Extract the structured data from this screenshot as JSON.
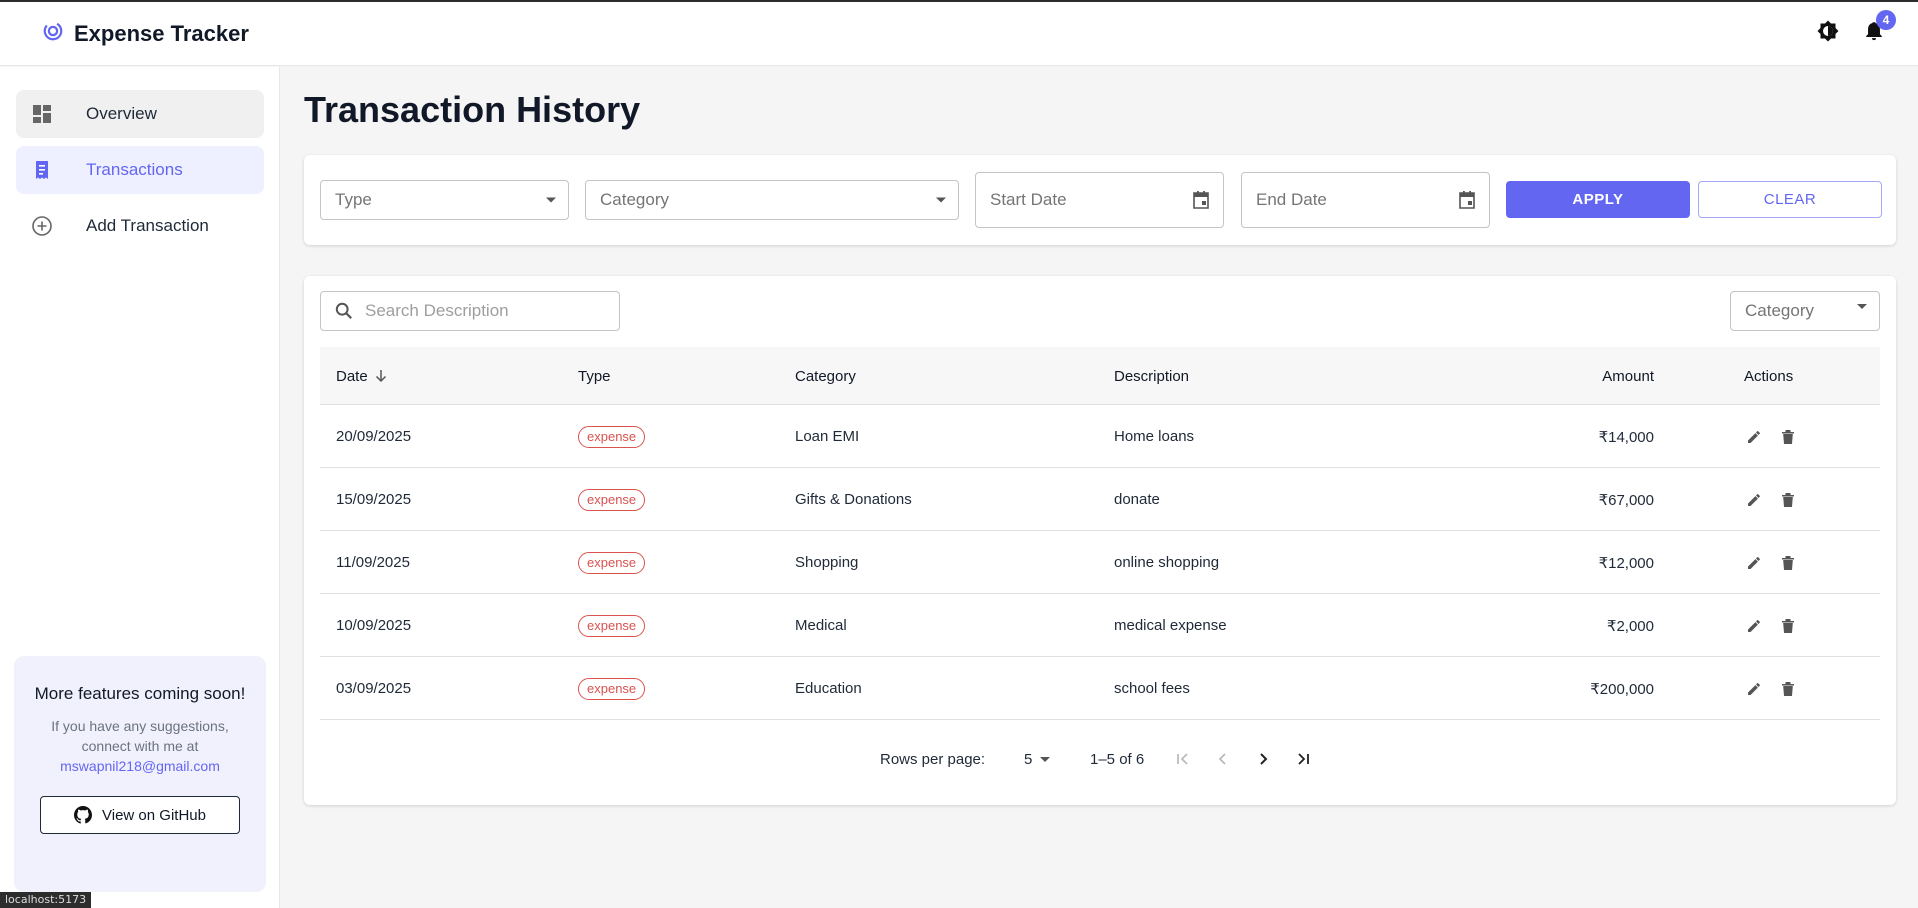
{
  "app": {
    "title": "Expense Tracker",
    "notification_count": "4",
    "accent": "#6366f1"
  },
  "sidebar": {
    "items": [
      {
        "label": "Overview",
        "icon": "dashboard-icon"
      },
      {
        "label": "Transactions",
        "icon": "receipt-icon"
      },
      {
        "label": "Add Transaction",
        "icon": "add-circle-icon"
      }
    ],
    "promo": {
      "title": "More features coming soon!",
      "text": "If you have any suggestions, connect with me at",
      "email": "mswapnil218@gmail.com",
      "button": "View on GitHub"
    }
  },
  "page": {
    "title": "Transaction History"
  },
  "filters": {
    "type_placeholder": "Type",
    "category_placeholder": "Category",
    "start_date_placeholder": "Start Date",
    "end_date_placeholder": "End Date",
    "apply_label": "APPLY",
    "clear_label": "CLEAR"
  },
  "table": {
    "search_placeholder": "Search Description",
    "category_filter": "Category",
    "columns": [
      "Date",
      "Type",
      "Category",
      "Description",
      "Amount",
      "Actions"
    ],
    "rows": [
      {
        "date": "20/09/2025",
        "type": "expense",
        "category": "Loan EMI",
        "description": "Home loans",
        "amount": "₹14,000"
      },
      {
        "date": "15/09/2025",
        "type": "expense",
        "category": "Gifts & Donations",
        "description": "donate",
        "amount": "₹67,000"
      },
      {
        "date": "11/09/2025",
        "type": "expense",
        "category": "Shopping",
        "description": "online shopping",
        "amount": "₹12,000"
      },
      {
        "date": "10/09/2025",
        "type": "expense",
        "category": "Medical",
        "description": "medical expense",
        "amount": "₹2,000"
      },
      {
        "date": "03/09/2025",
        "type": "expense",
        "category": "Education",
        "description": "school fees",
        "amount": "₹200,000"
      }
    ]
  },
  "pagination": {
    "rows_per_page_label": "Rows per page:",
    "rows_per_page_value": "5",
    "range": "1–5 of 6"
  },
  "status_bar": "localhost:5173"
}
